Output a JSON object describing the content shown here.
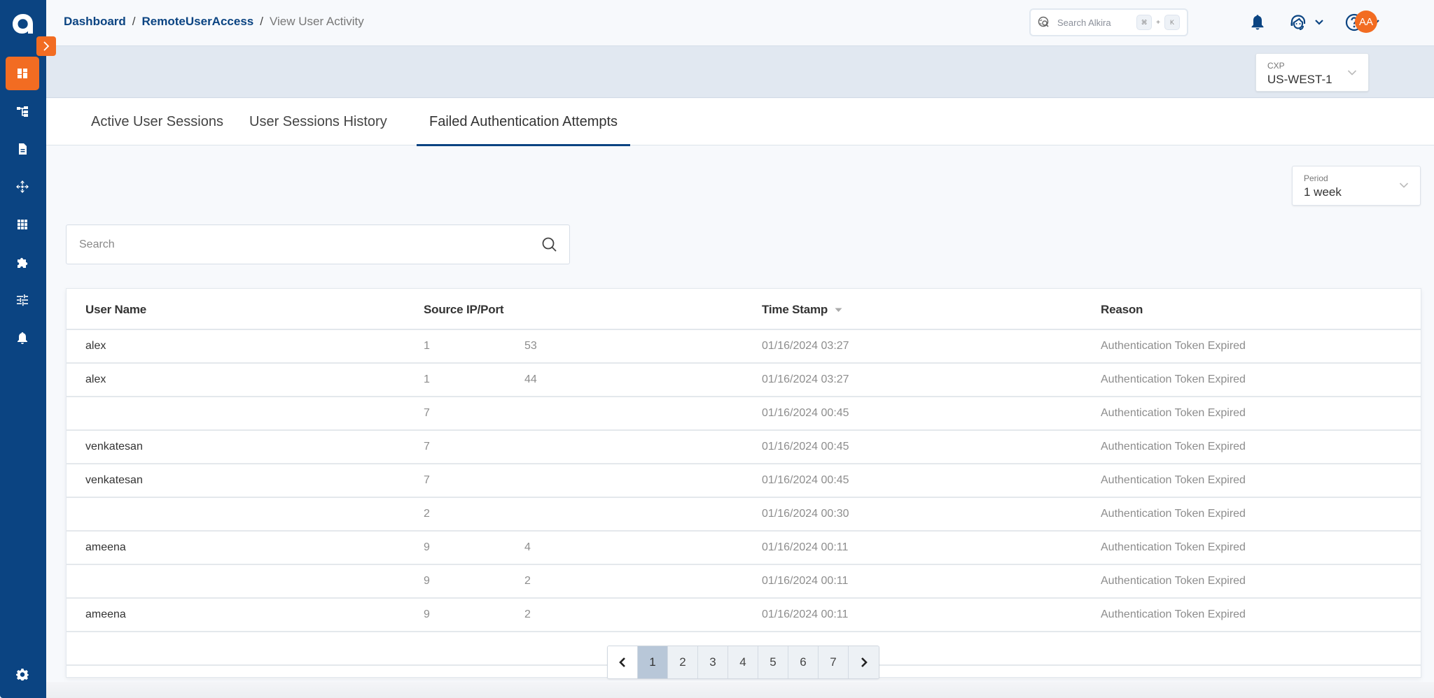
{
  "sidebar": {
    "logo": "alkira-logo-icon",
    "expand_toggle": "chevron-right-icon",
    "items": [
      {
        "name": "dashboard",
        "icon": "dashboard-icon",
        "active": true
      },
      {
        "name": "topology",
        "icon": "hierarchy-icon",
        "active": false
      },
      {
        "name": "documents",
        "icon": "document-icon",
        "active": false
      },
      {
        "name": "network",
        "icon": "move-arrows-icon",
        "active": false
      },
      {
        "name": "apps",
        "icon": "grid-icon",
        "active": false
      },
      {
        "name": "extensions",
        "icon": "puzzle-icon",
        "active": false
      },
      {
        "name": "policies",
        "icon": "sliders-icon",
        "active": false
      },
      {
        "name": "alerts",
        "icon": "bell-icon",
        "active": false
      }
    ],
    "bottom_item": {
      "name": "settings",
      "icon": "gear-icon"
    }
  },
  "header": {
    "breadcrumb": [
      {
        "label": "Dashboard",
        "link": true
      },
      {
        "label": "RemoteUserAccess",
        "link": true
      },
      {
        "label": "View User Activity",
        "link": false
      }
    ],
    "separator": "/",
    "search": {
      "placeholder": "Search Alkira",
      "shortcut_key1": "⌘",
      "shortcut_plus": "+",
      "shortcut_key2": "K"
    },
    "avatar_initials": "AA"
  },
  "cxp_select": {
    "label": "CXP",
    "value": "US-WEST-1"
  },
  "tabs": [
    {
      "label": "Active User Sessions",
      "active": false
    },
    {
      "label": "User Sessions History",
      "active": false
    },
    {
      "label": "Failed Authentication Attempts",
      "active": true
    }
  ],
  "period_select": {
    "label": "Period",
    "value": "1 week"
  },
  "table_search": {
    "placeholder": "Search",
    "value": ""
  },
  "table": {
    "columns": [
      "User Name",
      "Source IP/Port",
      "Time Stamp",
      "Reason"
    ],
    "sorted_column": "Time Stamp",
    "sort_direction": "descending",
    "rows": [
      {
        "user": "alex",
        "ip_start": "1",
        "ip_end": "53",
        "timestamp": "01/16/2024 03:27",
        "reason": "Authentication Token Expired"
      },
      {
        "user": "alex",
        "ip_start": "1",
        "ip_end": "44",
        "timestamp": "01/16/2024 03:27",
        "reason": "Authentication Token Expired"
      },
      {
        "user": "",
        "ip_start": "7",
        "ip_end": "",
        "timestamp": "01/16/2024 00:45",
        "reason": "Authentication Token Expired"
      },
      {
        "user": "venkatesan",
        "ip_start": "7",
        "ip_end": "",
        "timestamp": "01/16/2024 00:45",
        "reason": "Authentication Token Expired"
      },
      {
        "user": "venkatesan",
        "ip_start": "7",
        "ip_end": "",
        "timestamp": "01/16/2024 00:45",
        "reason": "Authentication Token Expired"
      },
      {
        "user": "",
        "ip_start": "2",
        "ip_end": "",
        "timestamp": "01/16/2024 00:30",
        "reason": "Authentication Token Expired"
      },
      {
        "user": "ameena",
        "ip_start": "9",
        "ip_end": "4",
        "timestamp": "01/16/2024 00:11",
        "reason": "Authentication Token Expired"
      },
      {
        "user": "",
        "ip_start": "9",
        "ip_end": "2",
        "timestamp": "01/16/2024 00:11",
        "reason": "Authentication Token Expired"
      },
      {
        "user": "ameena",
        "ip_start": "9",
        "ip_end": "2",
        "timestamp": "01/16/2024 00:11",
        "reason": "Authentication Token Expired"
      }
    ]
  },
  "pagination": {
    "prev": "chevron-left-icon",
    "next": "chevron-right-icon",
    "pages": [
      "1",
      "2",
      "3",
      "4",
      "5",
      "6",
      "7"
    ],
    "current_page": "1"
  },
  "colors": {
    "brand_blue": "#0b4482",
    "accent_orange": "#f26c22",
    "active_page": "#b8c7d8"
  }
}
